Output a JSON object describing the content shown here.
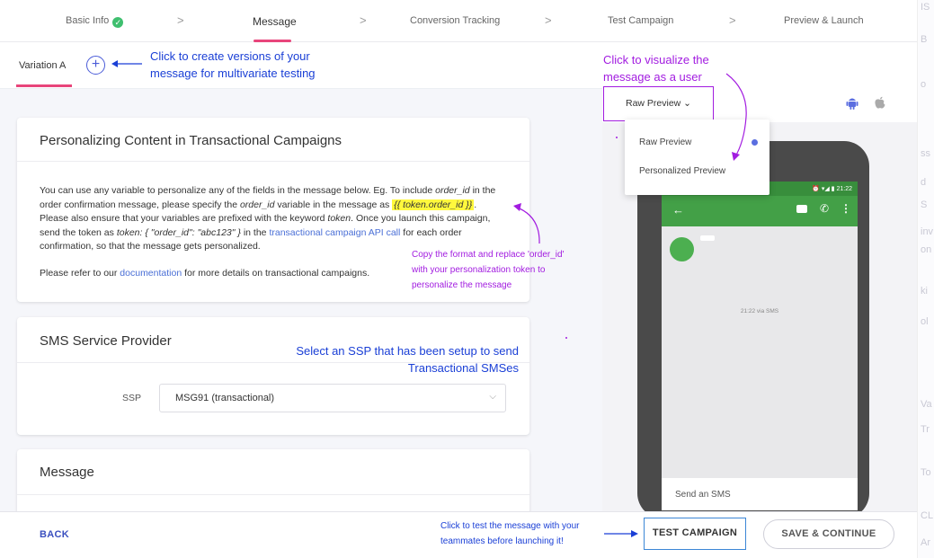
{
  "stepper": {
    "steps": [
      "Basic Info",
      "Message",
      "Conversion Tracking",
      "Test Campaign",
      "Preview & Launch"
    ],
    "check_glyph": "✓",
    "chevron_glyph": ">"
  },
  "variation": {
    "tab_label": "Variation A",
    "add_glyph": "+"
  },
  "cards": {
    "personalizing": {
      "title": "Personalizing Content in Transactional Campaigns",
      "p1_a": "You can use any variable to personalize any of the fields in the message below. Eg. To include ",
      "p1_var": "order_id",
      "p1_b": " in the order confirmation message, please specify the ",
      "p1_var2": "order_id",
      "p1_c": " variable in the message as ",
      "p1_token": "{{ token.order_id }}",
      "p1_d": ". Please also ensure that your variables are prefixed with the keyword ",
      "p1_kw": "token",
      "p1_e": ". Once you launch this campaign, send the token as ",
      "p1_code": "token: { \"order_id\": \"abc123\" }",
      "p1_f": " in the ",
      "p1_link": "transactional campaign API call",
      "p1_g": " for each order confirmation, so that the message gets personalized.",
      "p2_a": "Please refer to our ",
      "p2_link": "documentation",
      "p2_b": " for more details on transactional campaigns."
    },
    "ssp": {
      "title": "SMS Service Provider",
      "label": "SSP",
      "value": "MSG91 (transactional)",
      "arrow_glyph": "⌵"
    },
    "message": {
      "title": "Message"
    }
  },
  "preview": {
    "raw_button": "Raw Preview ⌄",
    "android_glyph": "🤖",
    "apple_glyph": "",
    "dropdown": [
      "Raw Preview",
      "Personalized Preview"
    ],
    "phone": {
      "status": "⏰ ▾◢ ▮ 21:22",
      "back_glyph": "←",
      "call_glyph": "✆",
      "more_glyph": "⋮",
      "time": "21:22 via SMS",
      "compose": "Send an SMS"
    }
  },
  "footer": {
    "back": "BACK",
    "test": "TEST CAMPAIGN",
    "save": "SAVE & CONTINUE"
  },
  "annotations": {
    "variation_1": "Click to create versions of your",
    "variation_2": "message for multivariate testing",
    "visualize_1": "Click to visualize the",
    "visualize_2": "message as a user",
    "token_1": "Copy the format and replace 'order_id'",
    "token_2": "with your personalization token to",
    "token_3": "personalize the message",
    "ssp_1": "Select an SSP that has been setup to send",
    "ssp_2": "Transactional SMSes",
    "test_1": "Click to test the message with your",
    "test_2": "teammates before launching it!"
  },
  "ghost_column": [
    "IS",
    "B",
    "o",
    "ss",
    "d",
    "S",
    "inv",
    "on",
    "ki",
    "ol",
    "Va",
    "Tr",
    "To",
    "CL",
    "Ar"
  ],
  "colors": {
    "accent_pink": "#e8457b",
    "link_blue": "#4a6fd6",
    "annotation_blue": "#1a3fd6",
    "annotation_purple": "#a21ce0",
    "sms_green": "#43a047",
    "highlight_yellow": "#fff83d"
  }
}
